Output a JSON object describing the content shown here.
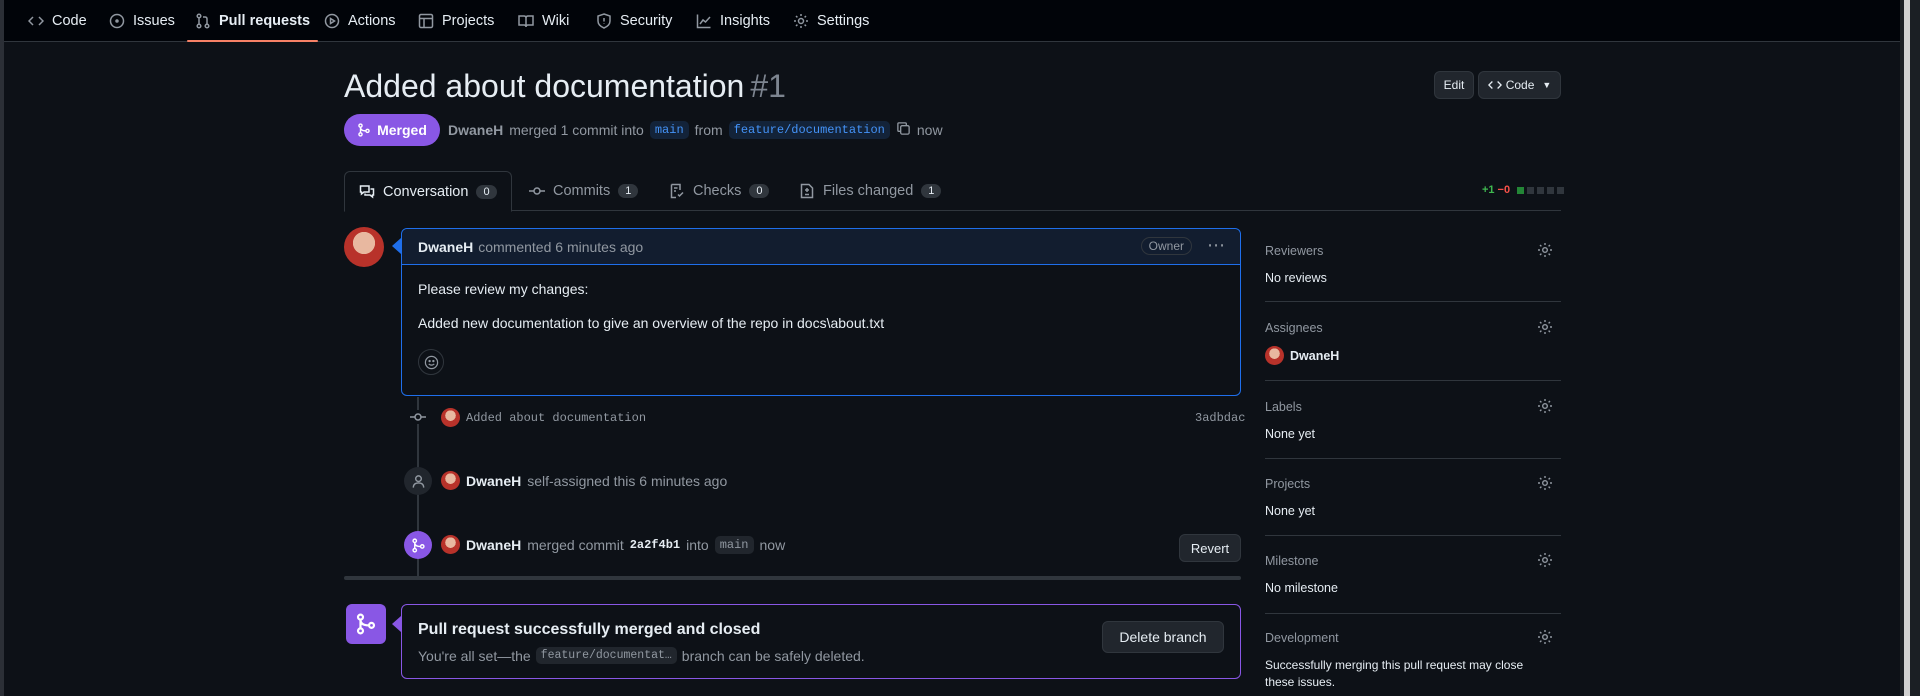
{
  "nav": {
    "items": [
      {
        "label": "Code",
        "icon": "code-icon"
      },
      {
        "label": "Issues",
        "icon": "issue-icon"
      },
      {
        "label": "Pull requests",
        "icon": "pull-request-icon",
        "active": true
      },
      {
        "label": "Actions",
        "icon": "play-icon"
      },
      {
        "label": "Projects",
        "icon": "table-icon"
      },
      {
        "label": "Wiki",
        "icon": "book-icon"
      },
      {
        "label": "Security",
        "icon": "shield-icon"
      },
      {
        "label": "Insights",
        "icon": "graph-icon"
      },
      {
        "label": "Settings",
        "icon": "gear-icon"
      }
    ]
  },
  "header": {
    "title": "Added about documentation",
    "number": "#1",
    "edit_label": "Edit",
    "code_label": "Code",
    "state": "Merged",
    "author": "DwaneH",
    "merged_text": "merged 1 commit into",
    "base_branch": "main",
    "from_text": "from",
    "head_branch": "feature/documentation",
    "time": "now"
  },
  "tabs": [
    {
      "label": "Conversation",
      "count": "0",
      "icon": "comment-discussion-icon"
    },
    {
      "label": "Commits",
      "count": "1",
      "icon": "commit-icon"
    },
    {
      "label": "Checks",
      "count": "0",
      "icon": "checklist-icon"
    },
    {
      "label": "Files changed",
      "count": "1",
      "icon": "file-diff-icon"
    }
  ],
  "diffstat": {
    "additions": "+1",
    "deletions": "−0"
  },
  "comment": {
    "author": "DwaneH",
    "action": "commented 6 minutes ago",
    "badge": "Owner",
    "line1": "Please review my changes:",
    "line2": "Added new documentation to give an overview of the repo in docs\\about.txt"
  },
  "timeline": {
    "commit_message": "Added about documentation",
    "commit_sha": "3adbdac",
    "assign_author": "DwaneH",
    "assign_text": "self-assigned this 6 minutes ago",
    "merge_author": "DwaneH",
    "merge_text": "merged commit",
    "merge_sha": "2a2f4b1",
    "merge_into": "into",
    "merge_branch": "main",
    "merge_time": "now",
    "revert_label": "Revert"
  },
  "merged_box": {
    "title": "Pull request successfully merged and closed",
    "sub_prefix": "You're all set—the",
    "branch": "feature/documentat…",
    "sub_suffix": "branch can be safely deleted.",
    "delete_label": "Delete branch"
  },
  "sidebar": {
    "reviewers": {
      "title": "Reviewers",
      "value": "No reviews"
    },
    "assignees": {
      "title": "Assignees",
      "value": "DwaneH"
    },
    "labels": {
      "title": "Labels",
      "value": "None yet"
    },
    "projects": {
      "title": "Projects",
      "value": "None yet"
    },
    "milestone": {
      "title": "Milestone",
      "value": "No milestone"
    },
    "development": {
      "title": "Development",
      "value": "Successfully merging this pull request may close these issues."
    }
  },
  "colors": {
    "merged": "#8957e5",
    "accent": "#f78166",
    "link": "#4493f8"
  }
}
